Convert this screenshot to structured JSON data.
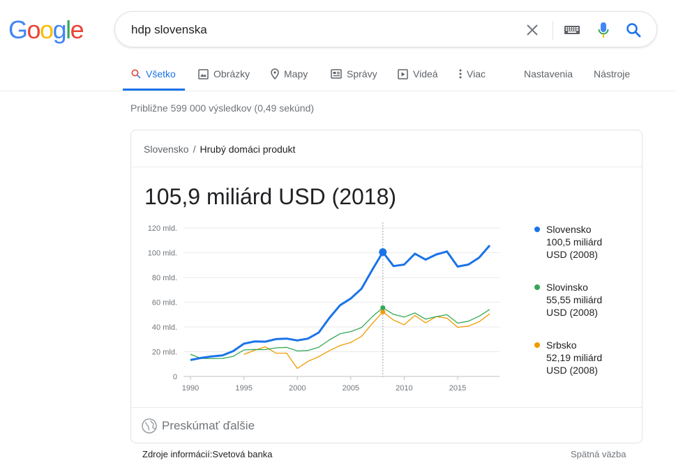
{
  "logo": {
    "letters": [
      "G",
      "o",
      "o",
      "g",
      "l",
      "e"
    ],
    "colors": [
      "#4285f4",
      "#ea4335",
      "#fbbc05",
      "#4285f4",
      "#34a853",
      "#ea4335"
    ]
  },
  "search": {
    "query": "hdp slovenska"
  },
  "tabs": [
    {
      "label": "Všetko",
      "icon": "search-icon",
      "active": true
    },
    {
      "label": "Obrázky",
      "icon": "image-icon",
      "active": false
    },
    {
      "label": "Mapy",
      "icon": "map-pin-icon",
      "active": false
    },
    {
      "label": "Správy",
      "icon": "news-icon",
      "active": false
    },
    {
      "label": "Videá",
      "icon": "video-icon",
      "active": false
    },
    {
      "label": "Viac",
      "icon": "more-dots-icon",
      "active": false
    }
  ],
  "tools": {
    "settings": "Nastavenia",
    "tools": "Nástroje"
  },
  "stats": "Približne 599 000 výsledkov (0,49 sekúnd)",
  "card": {
    "breadcrumb": {
      "parent": "Slovensko",
      "separator": "/",
      "current": "Hrubý domáci produkt"
    },
    "headline": "105,9 miliárd USD (2018)",
    "explore": "Preskúmať ďalšie"
  },
  "footer": {
    "source": "Zdroje informácií:Svetová banka",
    "feedback": "Spätná väzba"
  },
  "chart_data": {
    "type": "line",
    "x": [
      1990,
      1991,
      1992,
      1993,
      1994,
      1995,
      1996,
      1997,
      1998,
      1999,
      2000,
      2001,
      2002,
      2003,
      2004,
      2005,
      2006,
      2007,
      2008,
      2009,
      2010,
      2011,
      2012,
      2013,
      2014,
      2015,
      2016,
      2017,
      2018
    ],
    "xticks": [
      1990,
      1995,
      2000,
      2005,
      2010,
      2015
    ],
    "yticks": [
      0,
      20,
      40,
      60,
      80,
      100,
      120
    ],
    "ytick_labels": [
      "0",
      "20 mld.",
      "40 mld.",
      "60 mld.",
      "80 mld.",
      "100 mld.",
      "120 mld."
    ],
    "xlim": [
      1990,
      2018
    ],
    "ylim": [
      0,
      120
    ],
    "grid": true,
    "highlight_x": 2008,
    "legend_position": "right",
    "series": [
      {
        "name": "Slovensko",
        "color": "#1a73e8",
        "label_value": "100,5 miliárd",
        "label_year": "USD (2008)",
        "values": [
          13.3,
          15.0,
          16.2,
          17.0,
          20.5,
          26.5,
          28.3,
          28.1,
          30.2,
          30.6,
          29.1,
          30.6,
          35.5,
          47.3,
          57.6,
          63.0,
          70.9,
          86.1,
          100.5,
          89.2,
          90.4,
          99.2,
          94.4,
          98.6,
          101.0,
          88.8,
          90.4,
          96.0,
          105.9
        ]
      },
      {
        "name": "Slovinsko",
        "color": "#34a853",
        "label_value": "55,55 miliárd",
        "label_year": "USD (2008)",
        "values": [
          18.0,
          14.6,
          14.4,
          14.6,
          16.3,
          21.4,
          21.8,
          21.7,
          23.1,
          23.5,
          20.6,
          21.0,
          23.6,
          29.6,
          34.5,
          36.3,
          39.5,
          48.2,
          55.55,
          50.2,
          48.0,
          51.3,
          46.3,
          48.4,
          49.9,
          43.1,
          44.7,
          48.6,
          54.2
        ]
      },
      {
        "name": "Srbsko",
        "color": "#f29900",
        "label_value": "52,19 miliárd",
        "label_year": "USD (2008)",
        "values": [
          null,
          null,
          null,
          null,
          null,
          17.8,
          21.1,
          24.0,
          18.9,
          18.8,
          6.5,
          12.2,
          16.0,
          20.9,
          25.0,
          27.5,
          32.3,
          42.7,
          52.19,
          45.6,
          41.8,
          49.3,
          43.3,
          48.4,
          47.1,
          39.7,
          40.7,
          44.2,
          50.6
        ]
      }
    ]
  }
}
